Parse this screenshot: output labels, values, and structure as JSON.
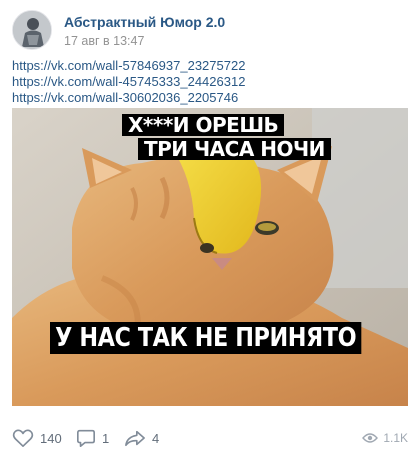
{
  "post": {
    "author": "Абстрактный Юмор 2.0",
    "date": "17 авг в 13:47",
    "links": [
      "https://vk.com/wall-57846937_23275722",
      "https://vk.com/wall-45745333_24426312",
      "https://vk.com/wall-30602036_2205746"
    ],
    "image": {
      "caption_top_line1": "Х***И ОРЕШЬ",
      "caption_top_line2": "ТРИ ЧАСА НОЧИ",
      "caption_bottom": "У НАС ТАК НЕ ПРИНЯТО"
    },
    "footer": {
      "likes": "140",
      "comments": "1",
      "shares": "4",
      "views": "1.1K"
    }
  },
  "icons": {
    "avatar": "community-avatar",
    "like": "heart-icon",
    "comment": "comment-icon",
    "share": "share-arrow-icon",
    "views": "eye-icon"
  },
  "colors": {
    "link": "#2a5885",
    "meta": "#939393",
    "action": "#818c99"
  }
}
